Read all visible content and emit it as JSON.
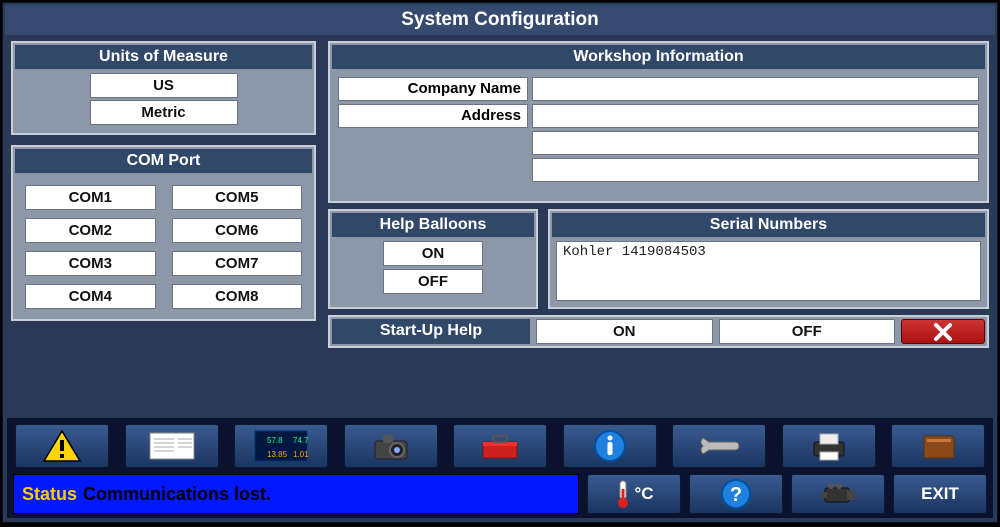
{
  "title": "System Configuration",
  "units": {
    "header": "Units of Measure",
    "options": [
      "US",
      "Metric"
    ]
  },
  "comport": {
    "header": "COM Port",
    "ports": [
      "COM1",
      "COM2",
      "COM3",
      "COM4",
      "COM5",
      "COM6",
      "COM7",
      "COM8"
    ]
  },
  "workshop": {
    "header": "Workshop Information",
    "company_label": "Company Name",
    "address_label": "Address",
    "company_value": "",
    "address_value": "",
    "extra1": "",
    "extra2": ""
  },
  "help_balloons": {
    "header": "Help Balloons",
    "on": "ON",
    "off": "OFF"
  },
  "serial": {
    "header": "Serial Numbers",
    "text": "Kohler   1419084503"
  },
  "startup": {
    "label": "Start-Up Help",
    "on": "ON",
    "off": "OFF"
  },
  "status": {
    "label": "Status",
    "message": "Communications lost."
  },
  "temp_label": "°C",
  "exit_label": "EXIT"
}
